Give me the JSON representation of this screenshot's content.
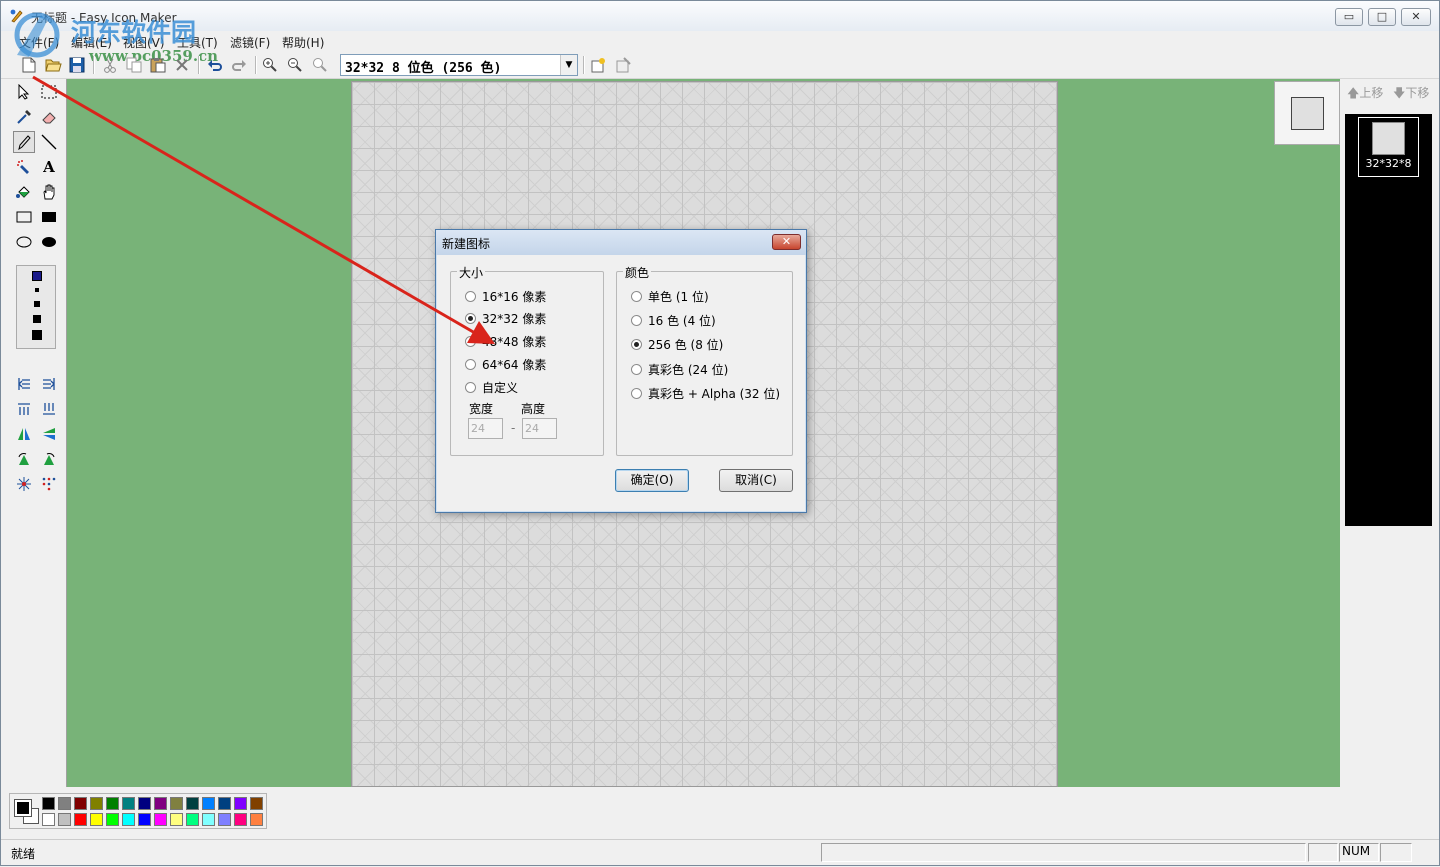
{
  "window": {
    "title": "无标题 - Easy Icon Maker",
    "minimize": "▭",
    "maximize": "□",
    "close": "✕"
  },
  "watermark": {
    "site_name": "河东软件园",
    "site_url": "www.pc0359.cn"
  },
  "menu": [
    {
      "label": "文件(F)"
    },
    {
      "label": "编辑(E)"
    },
    {
      "label": "视图(V)"
    },
    {
      "label": "工具(T)"
    },
    {
      "label": "滤镜(F)"
    },
    {
      "label": "帮助(H)"
    }
  ],
  "toolbar": {
    "format_value": "32*32  8 位色 (256 色)",
    "icons": [
      "new-file-icon",
      "open-folder-icon",
      "save-icon",
      "cut-icon",
      "copy-icon",
      "paste-icon",
      "delete-icon",
      "undo-icon",
      "redo-icon",
      "zoom-in-icon",
      "zoom-out-icon",
      "zoom-fit-icon",
      "add-format-icon",
      "delete-format-icon"
    ]
  },
  "right_panel": {
    "move_up": "上移",
    "move_down": "下移",
    "icon_item_caption": "32*32*8"
  },
  "dialog": {
    "title": "新建图标",
    "size_group_label": "大小",
    "size_options": [
      "16*16 像素",
      "32*32 像素",
      "48*48 像素",
      "64*64 像素",
      "自定义"
    ],
    "size_selected": "32*32 像素",
    "width_label": "宽度",
    "height_label": "高度",
    "width_value": "24",
    "height_value": "24",
    "separator": "-",
    "color_group_label": "颜色",
    "color_options": [
      "单色 (1 位)",
      "16 色 (4 位)",
      "256 色 (8 位)",
      "真彩色 (24 位)",
      "真彩色 + Alpha (32 位)"
    ],
    "color_selected": "256 色 (8 位)",
    "ok": "确定(O)",
    "cancel": "取消(C)"
  },
  "palette": {
    "top_row": [
      "#000000",
      "#808080",
      "#800000",
      "#808000",
      "#008000",
      "#008080",
      "#000080",
      "#800080",
      "#808040",
      "#004040",
      "#0080ff",
      "#004080",
      "#8000ff",
      "#804000"
    ],
    "bottom_row": [
      "#ffffff",
      "#c0c0c0",
      "#ff0000",
      "#ffff00",
      "#00ff00",
      "#00ffff",
      "#0000ff",
      "#ff00ff",
      "#ffff80",
      "#00ff80",
      "#80ffff",
      "#8080ff",
      "#ff0080",
      "#ff8040"
    ],
    "foreground": "#000000",
    "background": "#ffffff"
  },
  "status": {
    "text": "就绪",
    "num": "NUM"
  },
  "colors": {
    "workspace": "#78b378",
    "annotation_arrow": "#d9241b"
  }
}
